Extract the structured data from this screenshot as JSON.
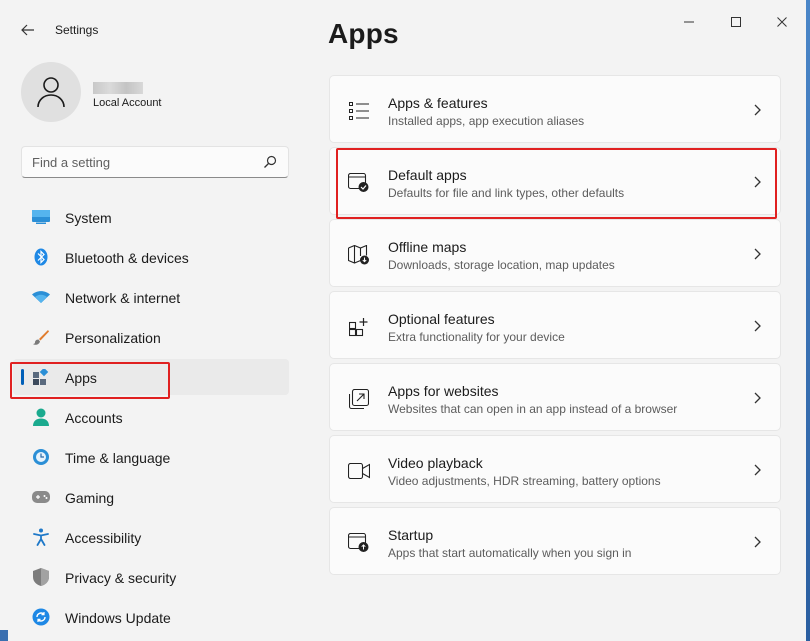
{
  "window": {
    "title": "Settings"
  },
  "user": {
    "account_type": "Local Account"
  },
  "search": {
    "placeholder": "Find a setting"
  },
  "sidebar": {
    "items": [
      {
        "label": "System",
        "icon": "monitor-icon"
      },
      {
        "label": "Bluetooth & devices",
        "icon": "bluetooth-icon"
      },
      {
        "label": "Network & internet",
        "icon": "wifi-icon"
      },
      {
        "label": "Personalization",
        "icon": "brush-icon"
      },
      {
        "label": "Apps",
        "icon": "apps-icon",
        "selected": true
      },
      {
        "label": "Accounts",
        "icon": "person-icon"
      },
      {
        "label": "Time & language",
        "icon": "clock-globe-icon"
      },
      {
        "label": "Gaming",
        "icon": "gamepad-icon"
      },
      {
        "label": "Accessibility",
        "icon": "accessibility-icon"
      },
      {
        "label": "Privacy & security",
        "icon": "shield-icon"
      },
      {
        "label": "Windows Update",
        "icon": "update-icon"
      }
    ]
  },
  "main": {
    "title": "Apps",
    "cards": [
      {
        "title": "Apps & features",
        "desc": "Installed apps, app execution aliases",
        "icon": "list-icon"
      },
      {
        "title": "Default apps",
        "desc": "Defaults for file and link types, other defaults",
        "icon": "default-apps-icon",
        "highlighted": true
      },
      {
        "title": "Offline maps",
        "desc": "Downloads, storage location, map updates",
        "icon": "map-download-icon"
      },
      {
        "title": "Optional features",
        "desc": "Extra functionality for your device",
        "icon": "add-grid-icon"
      },
      {
        "title": "Apps for websites",
        "desc": "Websites that can open in an app instead of a browser",
        "icon": "open-in-app-icon"
      },
      {
        "title": "Video playback",
        "desc": "Video adjustments, HDR streaming, battery options",
        "icon": "video-icon"
      },
      {
        "title": "Startup",
        "desc": "Apps that start automatically when you sign in",
        "icon": "startup-icon"
      }
    ]
  },
  "colors": {
    "accent": "#005fb8",
    "highlight": "#e02020"
  }
}
